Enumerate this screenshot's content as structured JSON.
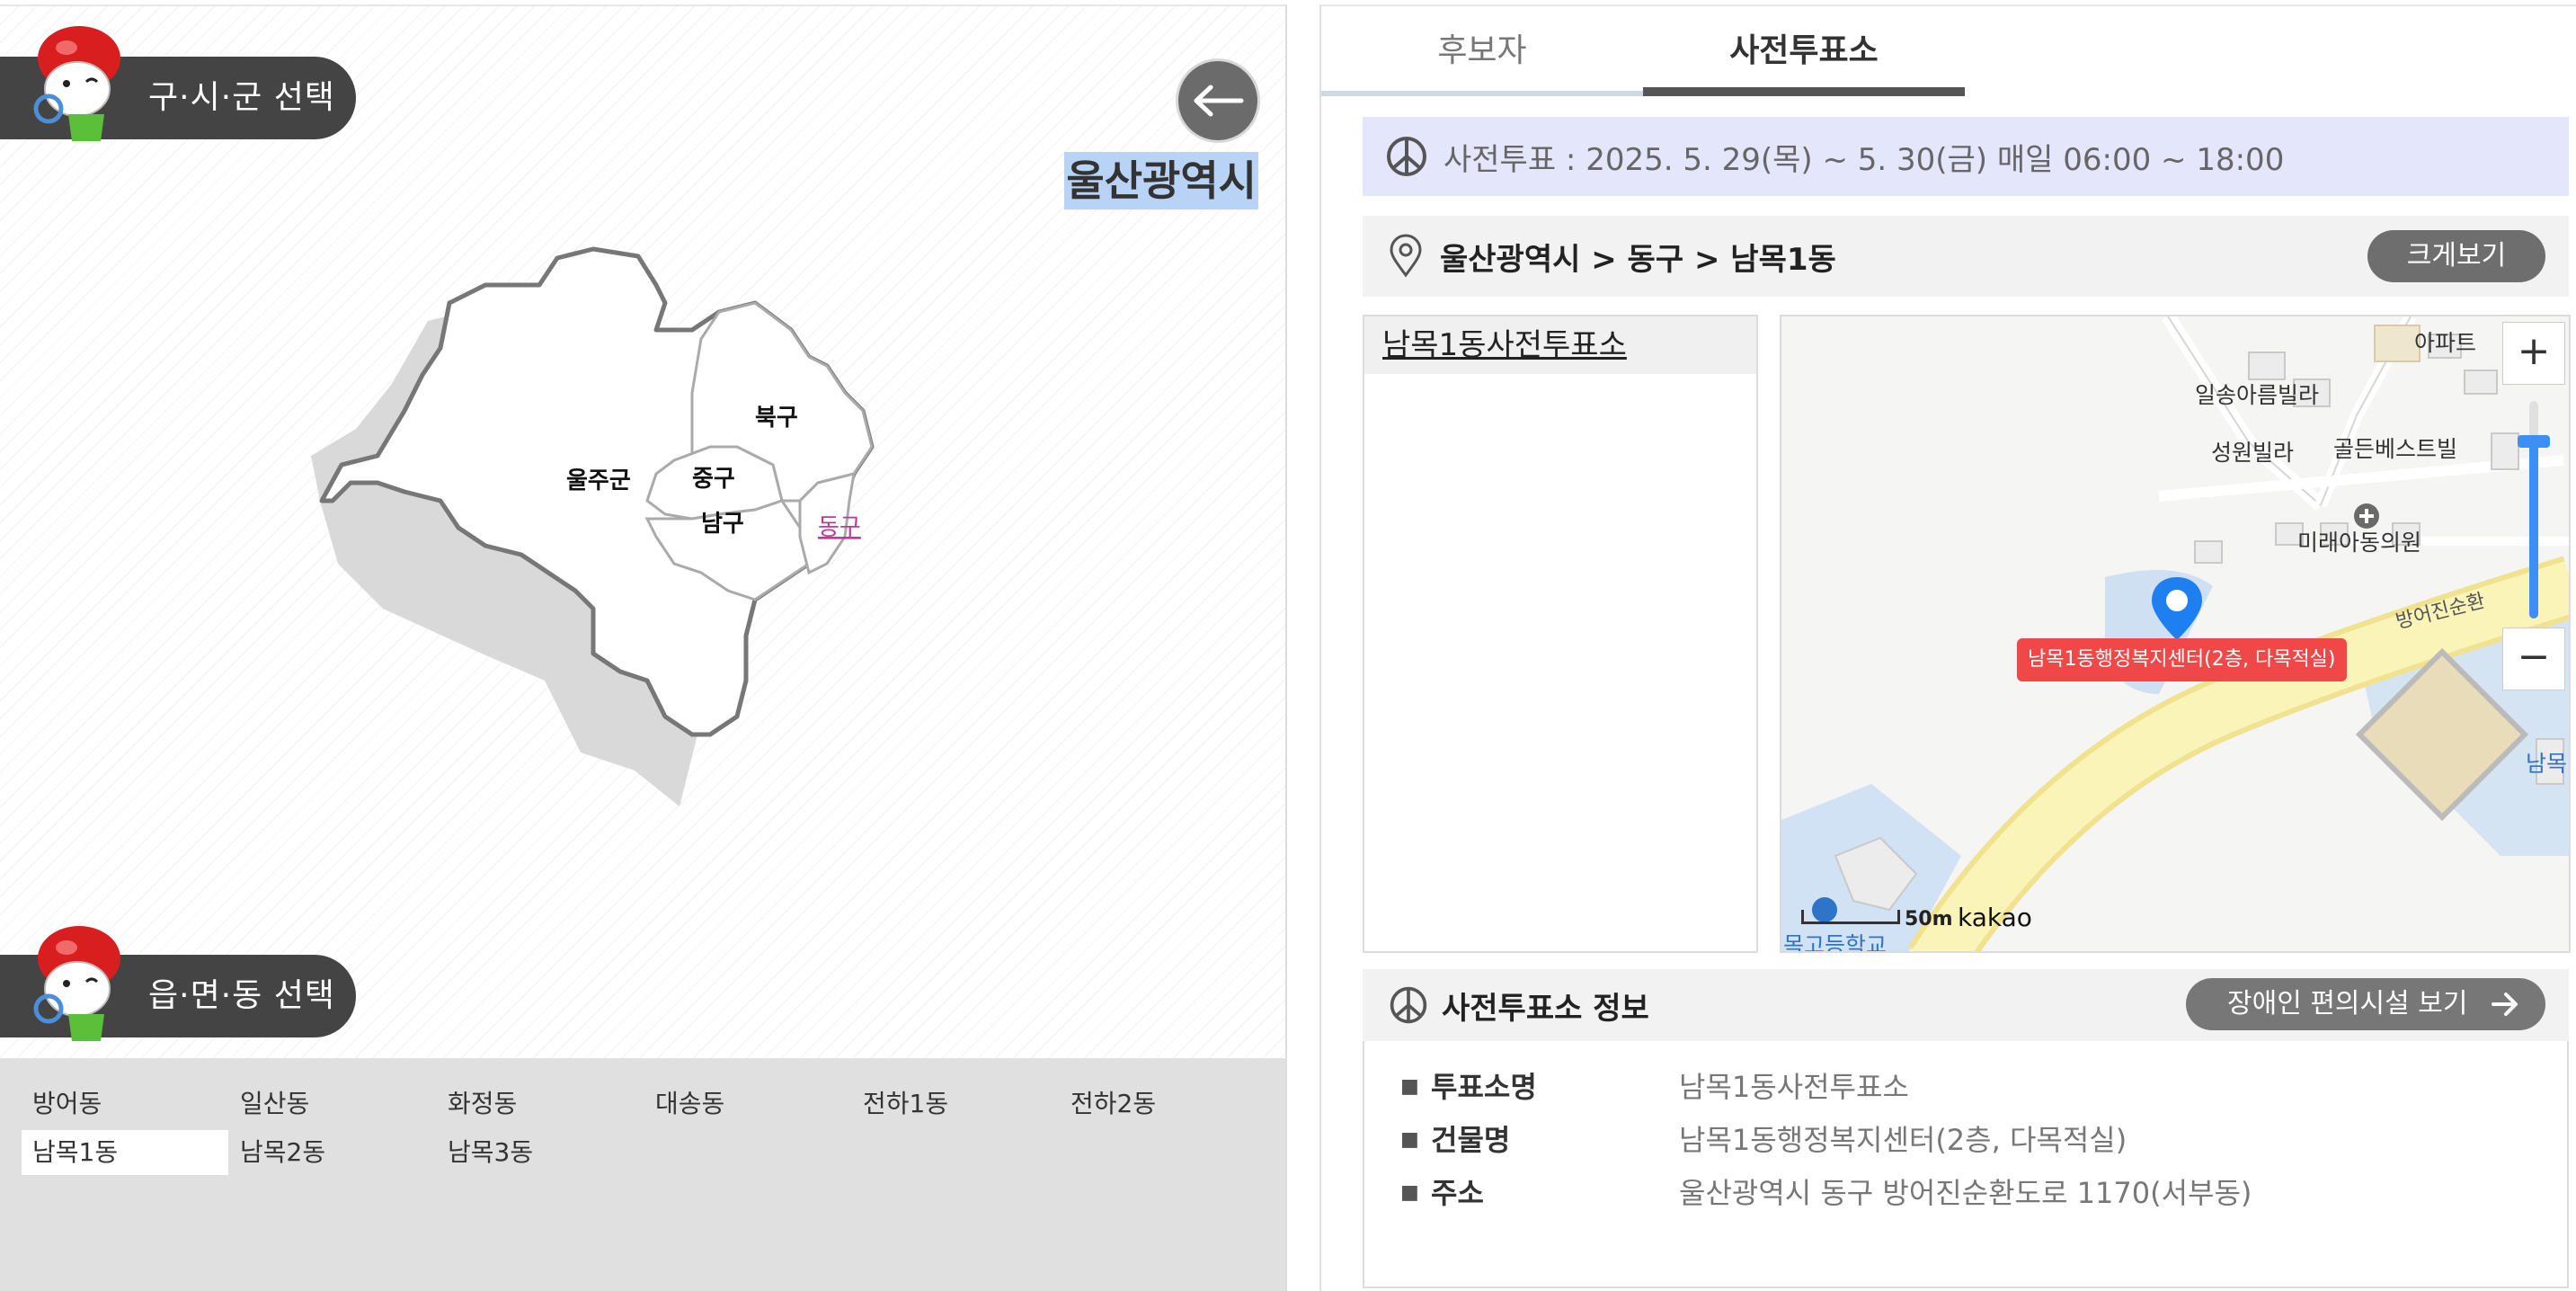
{
  "left": {
    "district_section_label": "구·시·군 선택",
    "dong_section_label": "읍·면·동 선택",
    "region_title": "울산광역시",
    "map_labels": {
      "ulju": "울주군",
      "jung": "중구",
      "buk": "북구",
      "nam": "남구",
      "dong": "동구"
    },
    "dongs": [
      "방어동",
      "일산동",
      "화정동",
      "대송동",
      "전하1동",
      "전하2동",
      "남목1동",
      "남목2동",
      "남목3동"
    ],
    "selected_dong": "남목1동"
  },
  "tabs": {
    "candidates": "후보자",
    "early_vote": "사전투표소",
    "active": "사전투표소"
  },
  "period": {
    "text": "사전투표 : 2025. 5. 29(목) ~ 5. 30(금) 매일 06:00 ~ 18:00"
  },
  "breadcrumb": {
    "text": "울산광역시 > 동구 > 남목1동",
    "enlarge_button": "크게보기"
  },
  "station_list": {
    "items": [
      "남목1동사전투표소"
    ]
  },
  "map": {
    "labels": {
      "ilsong": "일송아름빌라",
      "seongwon": "성원빌라",
      "golden": "골든베스트빌",
      "mirae": "미래아동의원",
      "apart": "아파트",
      "bangeo_road": "방어진순환",
      "nammok": "남목",
      "school": "목고등학교"
    },
    "marker_label": "남목1동행정복지센터(2층, 다목적실)",
    "scale_label": "50m",
    "logo": "kakao",
    "zoom_in": "+",
    "zoom_out": "−"
  },
  "info": {
    "title": "사전투표소 정보",
    "accessibility_button": "장애인 편의시설 보기",
    "rows": [
      {
        "label": "투표소명",
        "value": "남목1동사전투표소"
      },
      {
        "label": "건물명",
        "value": "남목1동행정복지센터(2층, 다목적실)"
      },
      {
        "label": "주소",
        "value": "울산광역시 동구 방어진순환도로 1170(서부동)"
      }
    ]
  },
  "colors": {
    "pill_bg": "#444444",
    "highlight": "#b8d3f5",
    "marker": "#f04848",
    "zoom_accent": "#3d8ff5",
    "dong_link": "#c0399a"
  }
}
